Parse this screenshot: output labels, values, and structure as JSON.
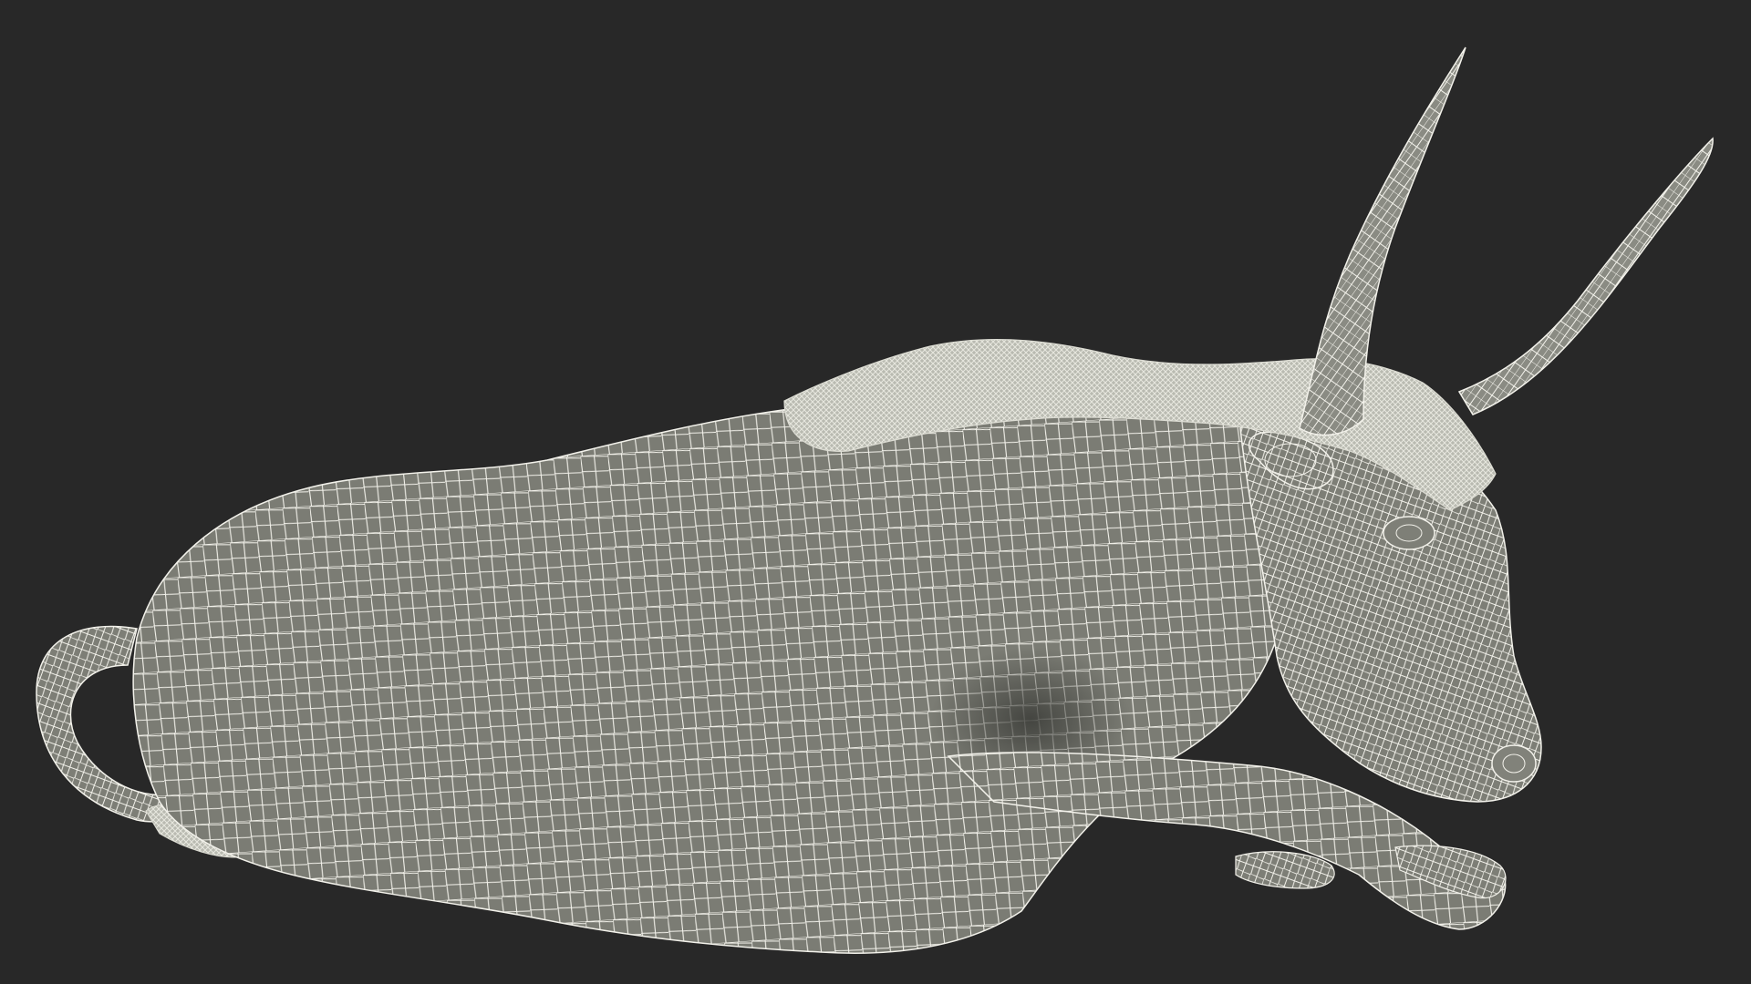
{
  "scene": {
    "subject": "bull-lying-down-wireframe",
    "background_color": "#282828",
    "mesh_fill_color": "#7b7c74",
    "mesh_shadow_color": "#4f504b",
    "wire_color": "#f2f1ea",
    "fur_color": "#cfd0c6"
  }
}
